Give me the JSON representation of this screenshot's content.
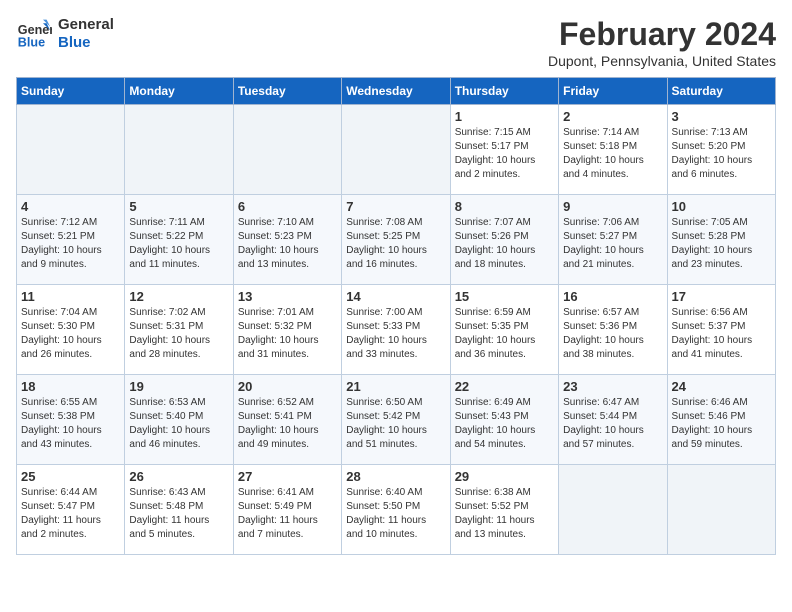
{
  "header": {
    "logo_line1": "General",
    "logo_line2": "Blue",
    "month_title": "February 2024",
    "location": "Dupont, Pennsylvania, United States"
  },
  "weekdays": [
    "Sunday",
    "Monday",
    "Tuesday",
    "Wednesday",
    "Thursday",
    "Friday",
    "Saturday"
  ],
  "weeks": [
    [
      {
        "day": "",
        "info": ""
      },
      {
        "day": "",
        "info": ""
      },
      {
        "day": "",
        "info": ""
      },
      {
        "day": "",
        "info": ""
      },
      {
        "day": "1",
        "info": "Sunrise: 7:15 AM\nSunset: 5:17 PM\nDaylight: 10 hours\nand 2 minutes."
      },
      {
        "day": "2",
        "info": "Sunrise: 7:14 AM\nSunset: 5:18 PM\nDaylight: 10 hours\nand 4 minutes."
      },
      {
        "day": "3",
        "info": "Sunrise: 7:13 AM\nSunset: 5:20 PM\nDaylight: 10 hours\nand 6 minutes."
      }
    ],
    [
      {
        "day": "4",
        "info": "Sunrise: 7:12 AM\nSunset: 5:21 PM\nDaylight: 10 hours\nand 9 minutes."
      },
      {
        "day": "5",
        "info": "Sunrise: 7:11 AM\nSunset: 5:22 PM\nDaylight: 10 hours\nand 11 minutes."
      },
      {
        "day": "6",
        "info": "Sunrise: 7:10 AM\nSunset: 5:23 PM\nDaylight: 10 hours\nand 13 minutes."
      },
      {
        "day": "7",
        "info": "Sunrise: 7:08 AM\nSunset: 5:25 PM\nDaylight: 10 hours\nand 16 minutes."
      },
      {
        "day": "8",
        "info": "Sunrise: 7:07 AM\nSunset: 5:26 PM\nDaylight: 10 hours\nand 18 minutes."
      },
      {
        "day": "9",
        "info": "Sunrise: 7:06 AM\nSunset: 5:27 PM\nDaylight: 10 hours\nand 21 minutes."
      },
      {
        "day": "10",
        "info": "Sunrise: 7:05 AM\nSunset: 5:28 PM\nDaylight: 10 hours\nand 23 minutes."
      }
    ],
    [
      {
        "day": "11",
        "info": "Sunrise: 7:04 AM\nSunset: 5:30 PM\nDaylight: 10 hours\nand 26 minutes."
      },
      {
        "day": "12",
        "info": "Sunrise: 7:02 AM\nSunset: 5:31 PM\nDaylight: 10 hours\nand 28 minutes."
      },
      {
        "day": "13",
        "info": "Sunrise: 7:01 AM\nSunset: 5:32 PM\nDaylight: 10 hours\nand 31 minutes."
      },
      {
        "day": "14",
        "info": "Sunrise: 7:00 AM\nSunset: 5:33 PM\nDaylight: 10 hours\nand 33 minutes."
      },
      {
        "day": "15",
        "info": "Sunrise: 6:59 AM\nSunset: 5:35 PM\nDaylight: 10 hours\nand 36 minutes."
      },
      {
        "day": "16",
        "info": "Sunrise: 6:57 AM\nSunset: 5:36 PM\nDaylight: 10 hours\nand 38 minutes."
      },
      {
        "day": "17",
        "info": "Sunrise: 6:56 AM\nSunset: 5:37 PM\nDaylight: 10 hours\nand 41 minutes."
      }
    ],
    [
      {
        "day": "18",
        "info": "Sunrise: 6:55 AM\nSunset: 5:38 PM\nDaylight: 10 hours\nand 43 minutes."
      },
      {
        "day": "19",
        "info": "Sunrise: 6:53 AM\nSunset: 5:40 PM\nDaylight: 10 hours\nand 46 minutes."
      },
      {
        "day": "20",
        "info": "Sunrise: 6:52 AM\nSunset: 5:41 PM\nDaylight: 10 hours\nand 49 minutes."
      },
      {
        "day": "21",
        "info": "Sunrise: 6:50 AM\nSunset: 5:42 PM\nDaylight: 10 hours\nand 51 minutes."
      },
      {
        "day": "22",
        "info": "Sunrise: 6:49 AM\nSunset: 5:43 PM\nDaylight: 10 hours\nand 54 minutes."
      },
      {
        "day": "23",
        "info": "Sunrise: 6:47 AM\nSunset: 5:44 PM\nDaylight: 10 hours\nand 57 minutes."
      },
      {
        "day": "24",
        "info": "Sunrise: 6:46 AM\nSunset: 5:46 PM\nDaylight: 10 hours\nand 59 minutes."
      }
    ],
    [
      {
        "day": "25",
        "info": "Sunrise: 6:44 AM\nSunset: 5:47 PM\nDaylight: 11 hours\nand 2 minutes."
      },
      {
        "day": "26",
        "info": "Sunrise: 6:43 AM\nSunset: 5:48 PM\nDaylight: 11 hours\nand 5 minutes."
      },
      {
        "day": "27",
        "info": "Sunrise: 6:41 AM\nSunset: 5:49 PM\nDaylight: 11 hours\nand 7 minutes."
      },
      {
        "day": "28",
        "info": "Sunrise: 6:40 AM\nSunset: 5:50 PM\nDaylight: 11 hours\nand 10 minutes."
      },
      {
        "day": "29",
        "info": "Sunrise: 6:38 AM\nSunset: 5:52 PM\nDaylight: 11 hours\nand 13 minutes."
      },
      {
        "day": "",
        "info": ""
      },
      {
        "day": "",
        "info": ""
      }
    ]
  ]
}
